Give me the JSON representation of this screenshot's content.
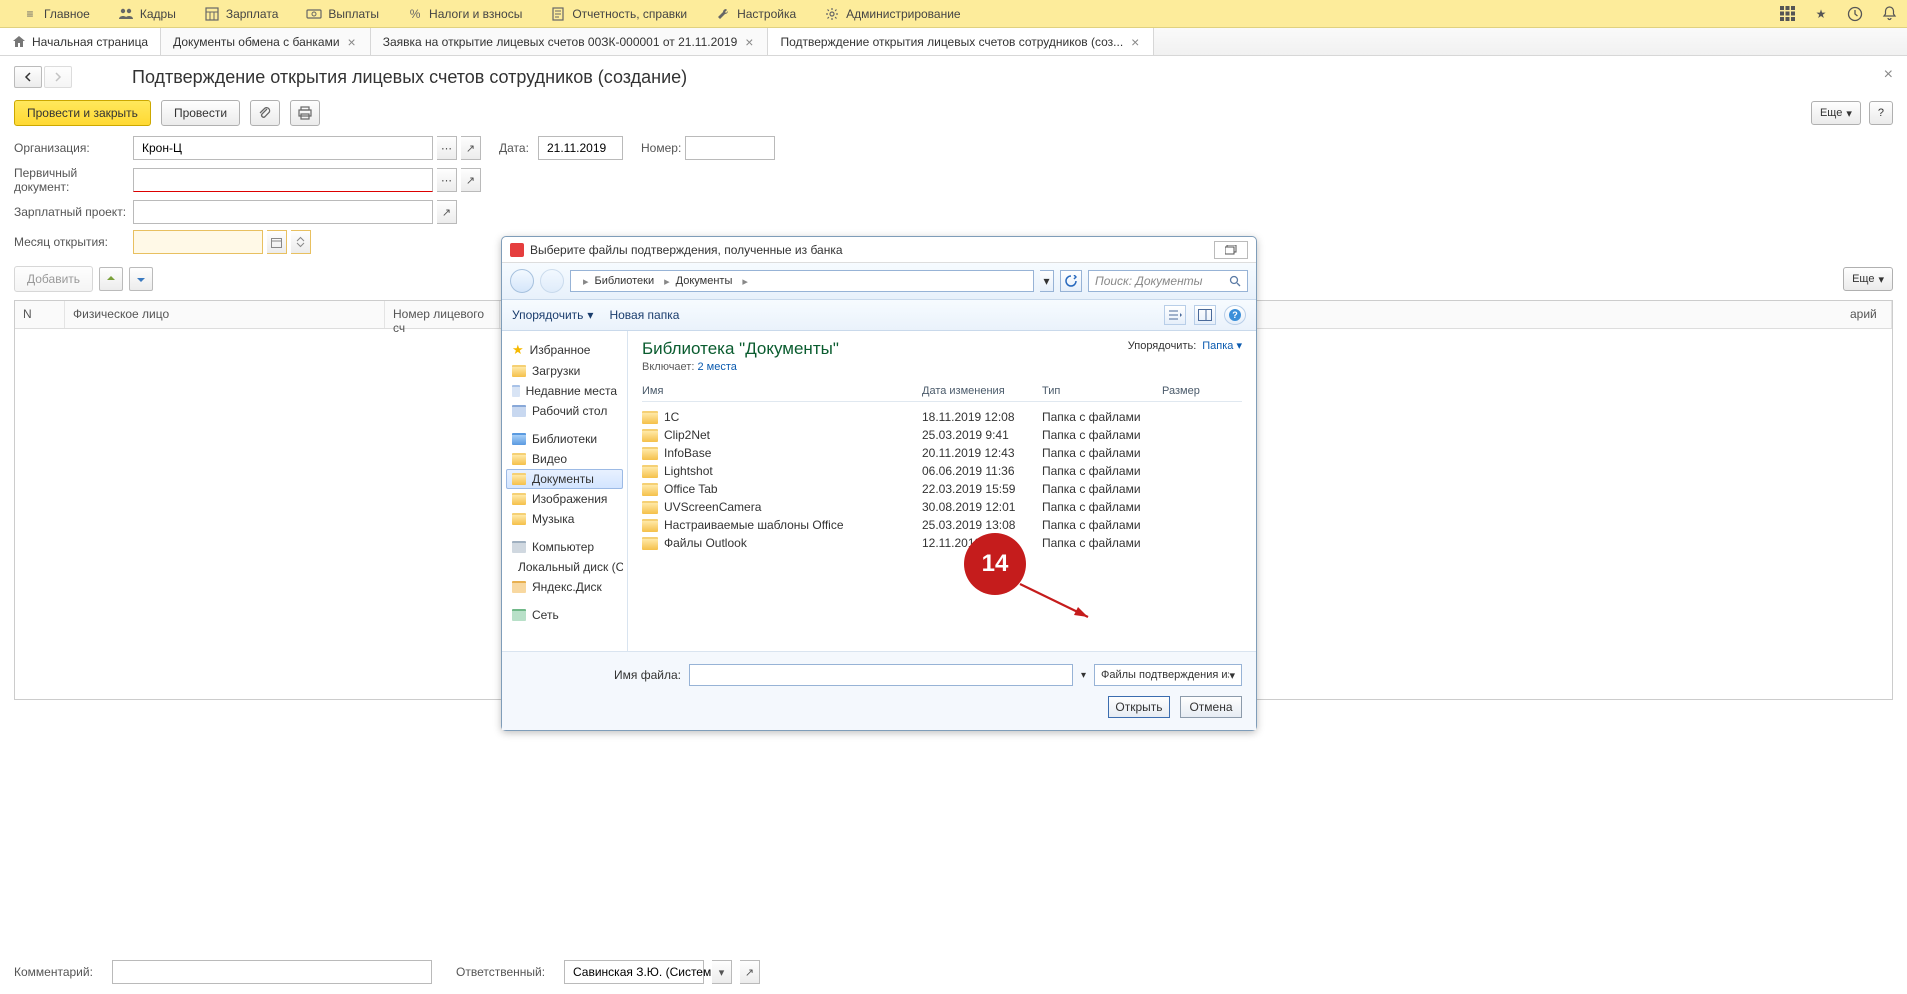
{
  "topnav": {
    "items": [
      {
        "label": "Главное"
      },
      {
        "label": "Кадры"
      },
      {
        "label": "Зарплата"
      },
      {
        "label": "Выплаты"
      },
      {
        "label": "Налоги и взносы"
      },
      {
        "label": "Отчетность, справки"
      },
      {
        "label": "Настройка"
      },
      {
        "label": "Администрирование"
      }
    ]
  },
  "tabs": {
    "home": "Начальная страница",
    "items": [
      {
        "label": "Документы обмена с банками"
      },
      {
        "label": "Заявка на открытие лицевых счетов 00ЗК-000001 от 21.11.2019"
      },
      {
        "label": "Подтверждение открытия лицевых счетов сотрудников (соз..."
      }
    ]
  },
  "page": {
    "title": "Подтверждение открытия лицевых счетов сотрудников (создание)"
  },
  "actions": {
    "process_close": "Провести и закрыть",
    "process": "Провести",
    "more": "Еще",
    "help": "?",
    "add": "Добавить"
  },
  "form": {
    "org_lbl": "Организация:",
    "org_val": "Крон-Ц",
    "date_lbl": "Дата:",
    "date_val": "21.11.2019",
    "num_lbl": "Номер:",
    "num_val": "",
    "doc_lbl": "Первичный документ:",
    "doc_val": "",
    "proj_lbl": "Зарплатный проект:",
    "proj_val": "",
    "month_lbl": "Месяц открытия:",
    "month_val": ""
  },
  "grid": {
    "cols": [
      "N",
      "Физическое лицо",
      "Номер лицевого сч",
      "",
      "",
      "арий"
    ]
  },
  "footer": {
    "comment_lbl": "Комментарий:",
    "resp_lbl": "Ответственный:",
    "resp_val": "Савинская З.Ю. (Систем"
  },
  "dialog": {
    "title": "Выберите файлы подтверждения, полученные из банка",
    "breadcrumb": [
      "Библиотеки",
      "Документы"
    ],
    "search_placeholder": "Поиск: Документы",
    "organize": "Упорядочить",
    "new_folder": "Новая папка",
    "side": {
      "fav": "Избранное",
      "downloads": "Загрузки",
      "recent": "Недавние места",
      "desktop": "Рабочий стол",
      "libs": "Библиотеки",
      "video": "Видео",
      "documents": "Документы",
      "pictures": "Изображения",
      "music": "Музыка",
      "computer": "Компьютер",
      "localdisk": "Локальный диск (C",
      "ydisk": "Яндекс.Диск",
      "network": "Сеть"
    },
    "main": {
      "lib_title": "Библиотека \"Документы\"",
      "includes": "Включает:",
      "places": "2 места",
      "sort_lbl": "Упорядочить:",
      "sort_val": "Папка",
      "col_name": "Имя",
      "col_date": "Дата изменения",
      "col_type": "Тип",
      "col_size": "Размер",
      "rows": [
        {
          "name": "1C",
          "date": "18.11.2019 12:08",
          "type": "Папка с файлами"
        },
        {
          "name": "Clip2Net",
          "date": "25.03.2019 9:41",
          "type": "Папка с файлами"
        },
        {
          "name": "InfoBase",
          "date": "20.11.2019 12:43",
          "type": "Папка с файлами"
        },
        {
          "name": "Lightshot",
          "date": "06.06.2019 11:36",
          "type": "Папка с файлами"
        },
        {
          "name": "Office Tab",
          "date": "22.03.2019 15:59",
          "type": "Папка с файлами"
        },
        {
          "name": "UVScreenCamera",
          "date": "30.08.2019 12:01",
          "type": "Папка с файлами"
        },
        {
          "name": "Настраиваемые шаблоны Office",
          "date": "25.03.2019 13:08",
          "type": "Папка с файлами"
        },
        {
          "name": "Файлы Outlook",
          "date": "12.11.2019 14:38",
          "type": "Папка с файлами"
        }
      ]
    },
    "filename_lbl": "Имя файла:",
    "type_filter": "Файлы подтверждения из бан",
    "open": "Открыть",
    "cancel": "Отмена"
  },
  "annotation": {
    "num": "14"
  }
}
